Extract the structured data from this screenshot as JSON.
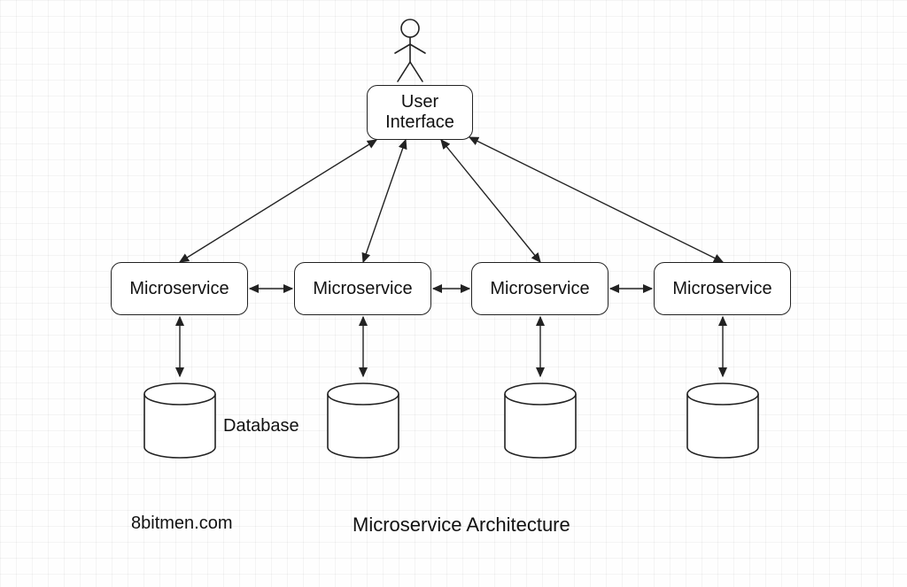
{
  "actor": {
    "name": "user-actor"
  },
  "ui_box": {
    "line1": "User",
    "line2": "Interface"
  },
  "microservices": [
    {
      "label": "Microservice"
    },
    {
      "label": "Microservice"
    },
    {
      "label": "Microservice"
    },
    {
      "label": "Microservice"
    }
  ],
  "database_label": "Database",
  "title": "Microservice Architecture",
  "attribution": "8bitmen.com"
}
